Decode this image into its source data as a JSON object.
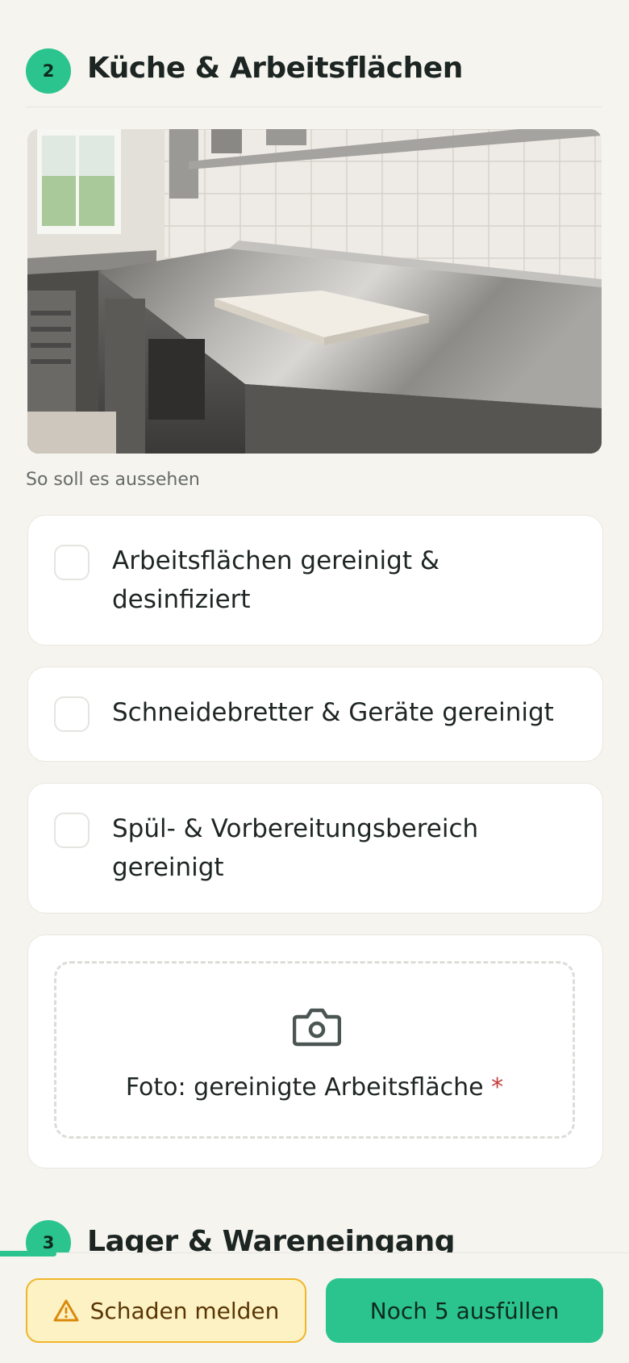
{
  "section2": {
    "number": "2",
    "title": "Küche & Arbeitsflächen"
  },
  "reference": {
    "caption": "So soll es aussehen"
  },
  "checklist": [
    {
      "label": "Arbeitsflächen gereinigt & desinfiziert",
      "checked": false
    },
    {
      "label": "Schneidebretter & Geräte gereinigt",
      "checked": false
    },
    {
      "label": "Spül- & Vorbereitungsbereich gereinigt",
      "checked": false
    }
  ],
  "photo_upload": {
    "label": "Foto: gereinigte Arbeitsfläche",
    "required_mark": "*",
    "icon": "camera-icon"
  },
  "section3": {
    "number": "3",
    "title": "Lager & Wareneingang"
  },
  "footer": {
    "report_label": "Schaden melden",
    "report_icon": "warning-icon",
    "fill_label": "Noch 5 ausfüllen",
    "progress_fraction": 0.09
  },
  "colors": {
    "accent": "#2bc48f",
    "warning_bg": "#fdf2c4",
    "warning_border": "#f0b62b",
    "required": "#c43b3b"
  }
}
